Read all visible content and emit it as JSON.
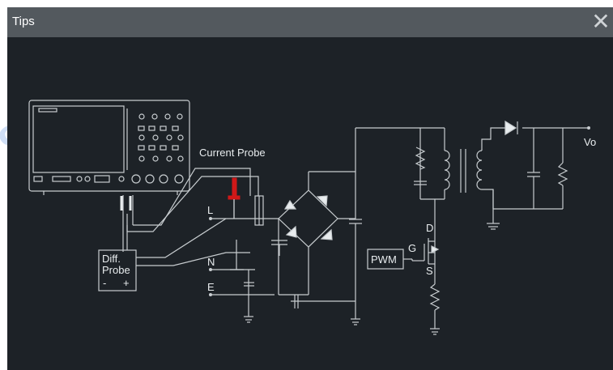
{
  "dialog": {
    "title": "Tips",
    "close_glyph": "✕"
  },
  "diagram": {
    "labels": {
      "current_probe": "Current Probe",
      "diff_probe_line1": "Diff.",
      "diff_probe_line2": "Probe",
      "diff_probe_minus": "-",
      "diff_probe_plus": "+",
      "line": "L",
      "neutral": "N",
      "earth": "E",
      "pwm": "PWM",
      "gate": "G",
      "drain": "D",
      "source": "S",
      "output": "Vo"
    }
  },
  "watermark": "сулерсйс",
  "colors": {
    "background": "#1d2227",
    "titlebar": "#53595e",
    "wire": "#c8cdd0",
    "probe_tip": "#d01818"
  }
}
